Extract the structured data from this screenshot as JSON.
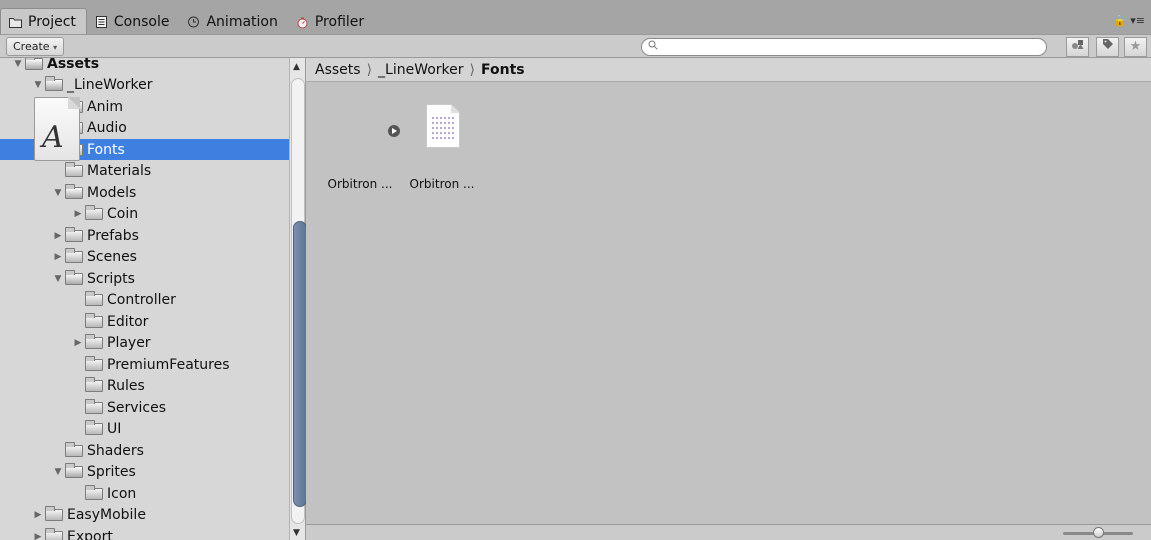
{
  "tabs": [
    {
      "label": "Project",
      "icon": "folder-icon",
      "active": true
    },
    {
      "label": "Console",
      "icon": "console-icon",
      "active": false
    },
    {
      "label": "Animation",
      "icon": "animation-clock-icon",
      "active": false
    },
    {
      "label": "Profiler",
      "icon": "profiler-icon",
      "active": false
    }
  ],
  "window_menu": {
    "icon": "lock-icon"
  },
  "toolbar": {
    "create_label": "Create",
    "search": {
      "value": "",
      "placeholder": ""
    },
    "buttons": [
      "filter-by-type-icon",
      "filter-by-label-icon",
      "favorite-star-icon"
    ]
  },
  "tree": [
    {
      "label": "Assets",
      "depth": 0,
      "expanded": true,
      "has_children": true,
      "bold": true
    },
    {
      "label": "_LineWorker",
      "depth": 1,
      "expanded": true,
      "has_children": true
    },
    {
      "label": "Anim",
      "depth": 2,
      "has_children": false
    },
    {
      "label": "Audio",
      "depth": 2,
      "has_children": false
    },
    {
      "label": "Fonts",
      "depth": 2,
      "has_children": false,
      "selected": true
    },
    {
      "label": "Materials",
      "depth": 2,
      "has_children": false
    },
    {
      "label": "Models",
      "depth": 2,
      "expanded": true,
      "has_children": true
    },
    {
      "label": "Coin",
      "depth": 3,
      "expanded": false,
      "has_children": true
    },
    {
      "label": "Prefabs",
      "depth": 2,
      "expanded": false,
      "has_children": true
    },
    {
      "label": "Scenes",
      "depth": 2,
      "expanded": false,
      "has_children": true
    },
    {
      "label": "Scripts",
      "depth": 2,
      "expanded": true,
      "has_children": true
    },
    {
      "label": "Controller",
      "depth": 3,
      "has_children": false
    },
    {
      "label": "Editor",
      "depth": 3,
      "has_children": false
    },
    {
      "label": "Player",
      "depth": 3,
      "expanded": false,
      "has_children": true
    },
    {
      "label": "PremiumFeatures",
      "depth": 3,
      "has_children": false
    },
    {
      "label": "Rules",
      "depth": 3,
      "has_children": false
    },
    {
      "label": "Services",
      "depth": 3,
      "has_children": false
    },
    {
      "label": "UI",
      "depth": 3,
      "has_children": false
    },
    {
      "label": "Shaders",
      "depth": 2,
      "has_children": false
    },
    {
      "label": "Sprites",
      "depth": 2,
      "expanded": true,
      "has_children": true
    },
    {
      "label": "Icon",
      "depth": 3,
      "has_children": false
    },
    {
      "label": "EasyMobile",
      "depth": 1,
      "expanded": false,
      "has_children": true
    },
    {
      "label": "Export",
      "depth": 1,
      "expanded": false,
      "has_children": true
    }
  ],
  "breadcrumb": [
    "Assets",
    "_LineWorker",
    "Fonts"
  ],
  "assets": [
    {
      "label": "Orbitron ...",
      "icon": "font-asset-icon",
      "glyph": "A",
      "has_subassets": true
    },
    {
      "label": "Orbitron ...",
      "icon": "text-document-icon"
    }
  ],
  "colors": {
    "selection": "#3d80df",
    "panel": "#c2c2c2",
    "tree_bg": "#d7d7d7"
  }
}
